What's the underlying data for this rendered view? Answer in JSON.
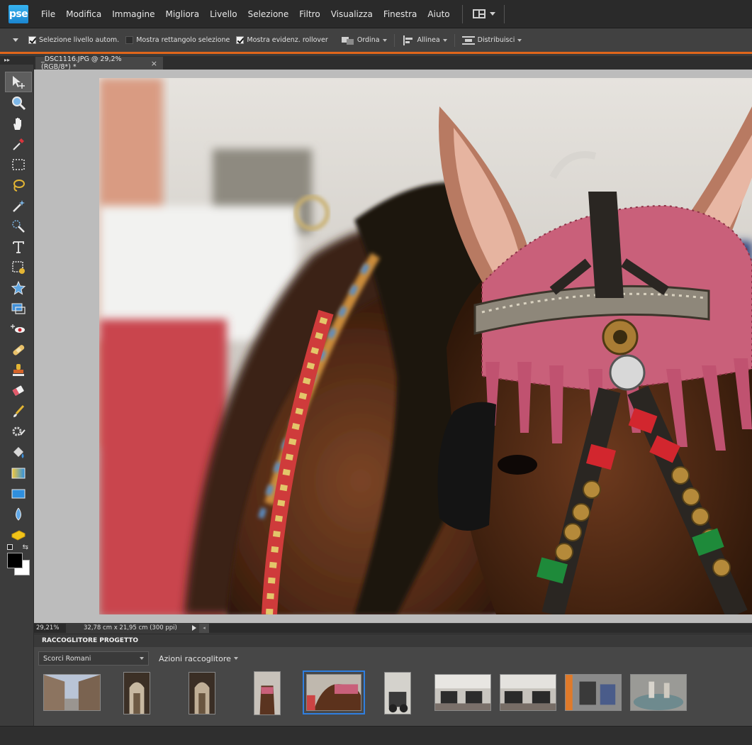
{
  "app": {
    "logo": "pse"
  },
  "menu": [
    "File",
    "Modifica",
    "Immagine",
    "Migliora",
    "Livello",
    "Selezione",
    "Filtro",
    "Visualizza",
    "Finestra",
    "Aiuto"
  ],
  "options": {
    "auto_select_layer": {
      "label": "Selezione livello autom.",
      "checked": true
    },
    "show_bounding_box": {
      "label": "Mostra rettangolo selezione",
      "checked": false
    },
    "show_rollover": {
      "label": "Mostra evidenz. rollover",
      "checked": true
    },
    "arrange": "Ordina",
    "align": "Allinea",
    "distribute": "Distribuisci"
  },
  "toolbox": {
    "header": "▸▸"
  },
  "document": {
    "tab_title": "_DSC1116.JPG @ 29,2% (RGB/8*) *",
    "close": "×"
  },
  "status": {
    "zoom": "29,21%",
    "doc_size": "32,78 cm x 21,95 cm (300 ppi)"
  },
  "bin": {
    "title": "RACCOGLITORE PROGETTO",
    "album": "Scorci Romani",
    "actions": "Azioni raccoglitore"
  },
  "colors": {
    "accent": "#e0661b",
    "selection": "#2f7fe0",
    "foreground": "#000000",
    "background": "#ffffff"
  }
}
